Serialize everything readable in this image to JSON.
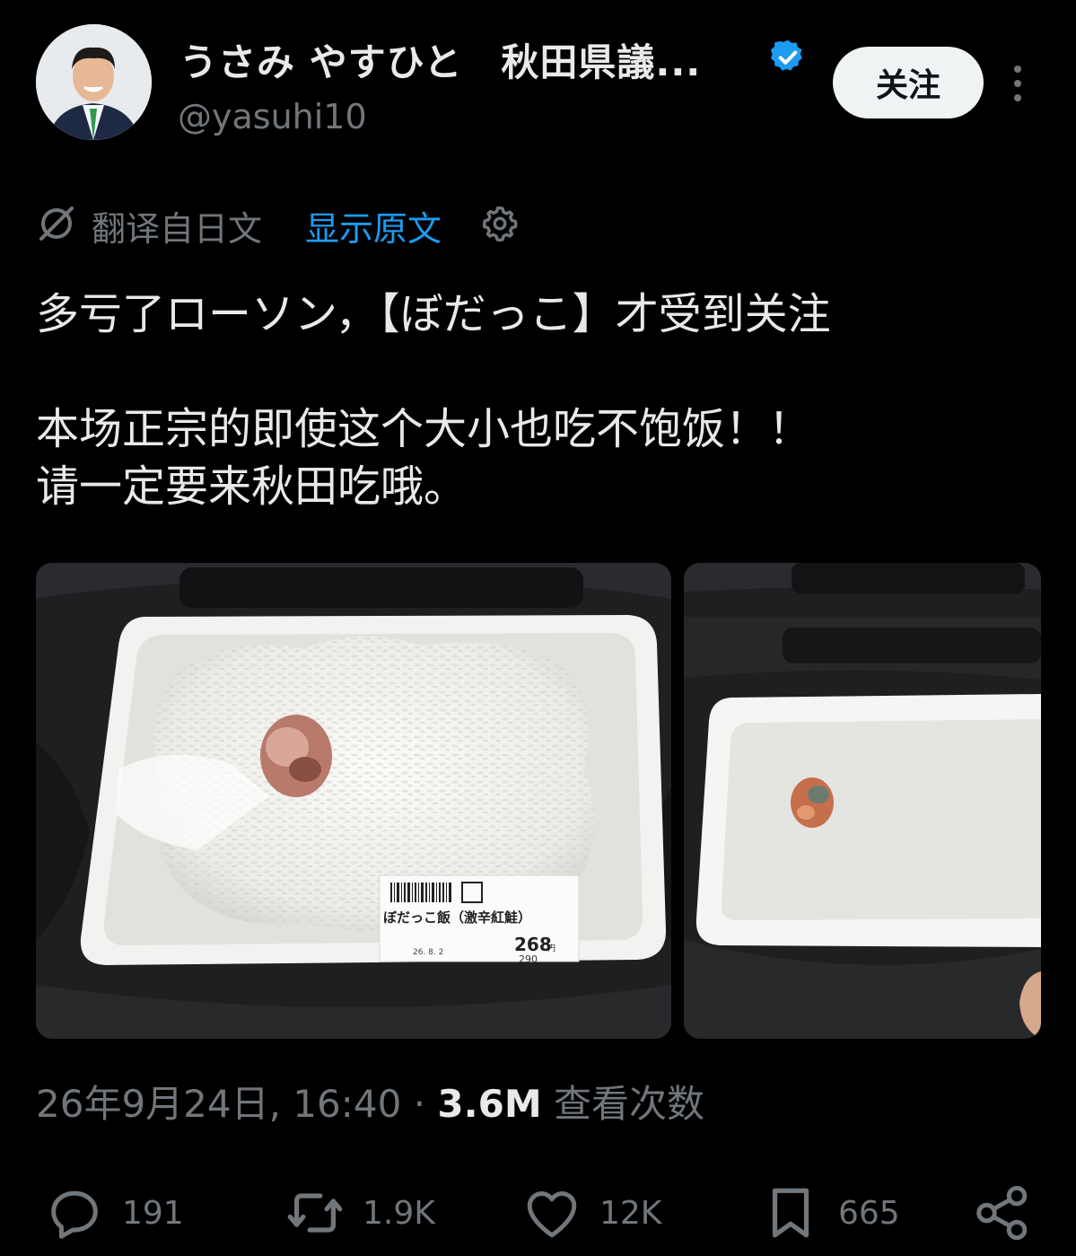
{
  "author": {
    "display_name": "うさみ やすひと　秋田県議...",
    "handle": "@yasuhi10",
    "follow_label": "关注",
    "verified_color": "#1d9bf0"
  },
  "translation": {
    "label": "翻译自日文",
    "show_original": "显示原文"
  },
  "tweet": {
    "lines": [
      "多亏了ローソン，【ぼだっこ】才受到关注",
      "本场正宗的即使这个大小也吃不饱饭！！",
      "请一定要来秋田吃哦。"
    ]
  },
  "media": {
    "photo1": {
      "label_name": "ぼだっこ飯（激辛紅鮭）",
      "label_price": "268",
      "label_price_yen": "円",
      "label_date": "26. 8. 2",
      "label_tax_price": "290"
    }
  },
  "meta": {
    "timestamp": "26年9月24日, 16:40",
    "separator": " · ",
    "views_count": "3.6M",
    "views_label": " 查看次数"
  },
  "actions": {
    "replies": "191",
    "reposts": "1.9K",
    "likes": "12K",
    "bookmarks": "665"
  },
  "colors": {
    "background": "#000000",
    "text": "#e7e9ea",
    "secondary": "#71767b",
    "link": "#1d9bf0"
  }
}
